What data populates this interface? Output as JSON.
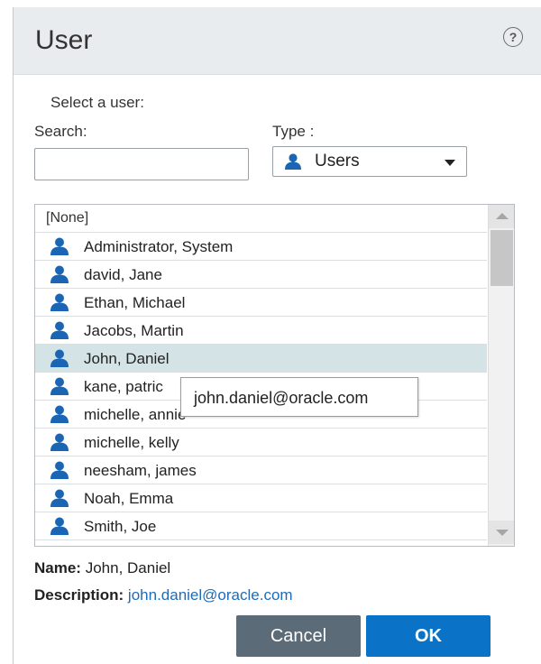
{
  "dialog": {
    "title": "User",
    "help_icon": "help-icon",
    "help_glyph": "?"
  },
  "form": {
    "select_label": "Select a user:",
    "search_label": "Search:",
    "search_value": "",
    "type_label": "Type :",
    "type_value": "Users",
    "type_icon": "user-icon"
  },
  "list": {
    "none_label": "[None]",
    "items": [
      {
        "name": "Administrator, System",
        "icon": "user-icon",
        "selected": false
      },
      {
        "name": "david, Jane",
        "icon": "user-icon",
        "selected": false
      },
      {
        "name": "Ethan, Michael",
        "icon": "user-icon",
        "selected": false
      },
      {
        "name": "Jacobs, Martin",
        "icon": "user-icon",
        "selected": false
      },
      {
        "name": "John, Daniel",
        "icon": "user-icon",
        "selected": true
      },
      {
        "name": "kane, patric",
        "icon": "user-icon",
        "selected": false
      },
      {
        "name": "michelle, annie",
        "icon": "user-icon",
        "selected": false
      },
      {
        "name": "michelle, kelly",
        "icon": "user-icon",
        "selected": false
      },
      {
        "name": "neesham, james",
        "icon": "user-icon",
        "selected": false
      },
      {
        "name": "Noah, Emma",
        "icon": "user-icon",
        "selected": false
      },
      {
        "name": "Smith, Joe",
        "icon": "user-icon",
        "selected": false
      }
    ]
  },
  "tooltip": {
    "text": "john.daniel@oracle.com"
  },
  "details": {
    "name_label": "Name:",
    "name_value": "John, Daniel",
    "description_label": "Description:",
    "description_value": "john.daniel@oracle.com"
  },
  "buttons": {
    "cancel_label": "Cancel",
    "ok_label": "OK"
  },
  "colors": {
    "icon_blue": "#1b66b4",
    "selected_row": "#d3e3e6",
    "ok_button": "#0a73c7",
    "cancel_button": "#5b6b78",
    "link": "#1f6bb5"
  }
}
